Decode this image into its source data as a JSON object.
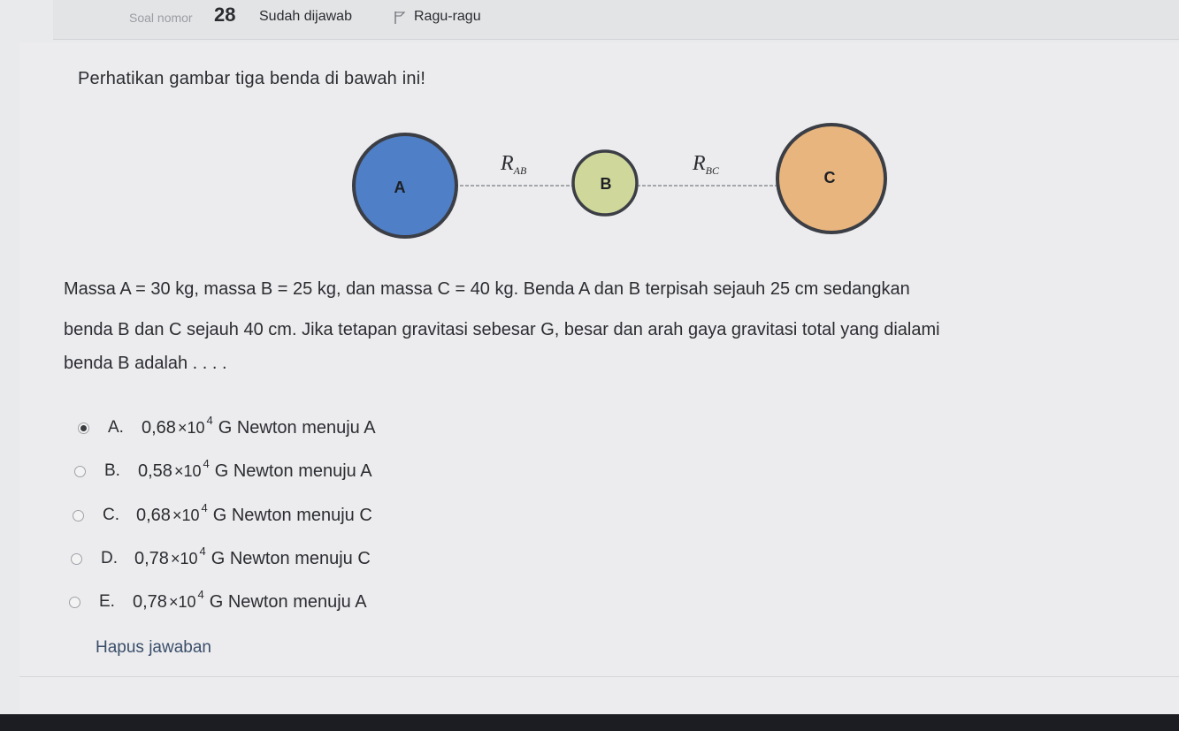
{
  "header": {
    "soal_label": "Soal nomor",
    "soal_number": "28",
    "answered_label": "Sudah dijawab",
    "flag_label": "Ragu-ragu"
  },
  "question": {
    "intro": "Perhatikan gambar tiga benda di bawah ini!",
    "figure": {
      "labels": [
        "A",
        "B",
        "C"
      ],
      "distance_labels": [
        {
          "main": "R",
          "sub": "AB"
        },
        {
          "main": "R",
          "sub": "BC"
        }
      ],
      "colors": {
        "A": "#4f7fc6",
        "B": "#cfd79b",
        "C": "#e8b57e",
        "outline": "#3b3e45"
      }
    },
    "statement_lines": [
      "Massa A = 30 kg, massa B = 25 kg, dan massa C =  40 kg. Benda A dan B terpisah sejauh 25 cm sedangkan",
      "benda B dan C sejauh 40 cm. Jika tetapan gravitasi sebesar G, besar dan arah gaya gravitasi total yang dialami",
      "benda B adalah . . . ."
    ]
  },
  "options": [
    {
      "letter": "A.",
      "coef": "0,68",
      "times": "×10",
      "exp": "4",
      "unit": "G Newton menuju A",
      "selected": true
    },
    {
      "letter": "B.",
      "coef": "0,58",
      "times": "×10",
      "exp": "4",
      "unit": "G Newton menuju A",
      "selected": false
    },
    {
      "letter": "C.",
      "coef": "0,68",
      "times": "×10",
      "exp": "4",
      "unit": "G Newton menuju C",
      "selected": false
    },
    {
      "letter": "D.",
      "coef": "0,78",
      "times": "×10",
      "exp": "4",
      "unit": "G Newton menuju C",
      "selected": false
    },
    {
      "letter": "E.",
      "coef": "0,78",
      "times": "×10",
      "exp": "4",
      "unit": "G Newton menuju A",
      "selected": false
    }
  ],
  "clear_label": "Hapus jawaban"
}
